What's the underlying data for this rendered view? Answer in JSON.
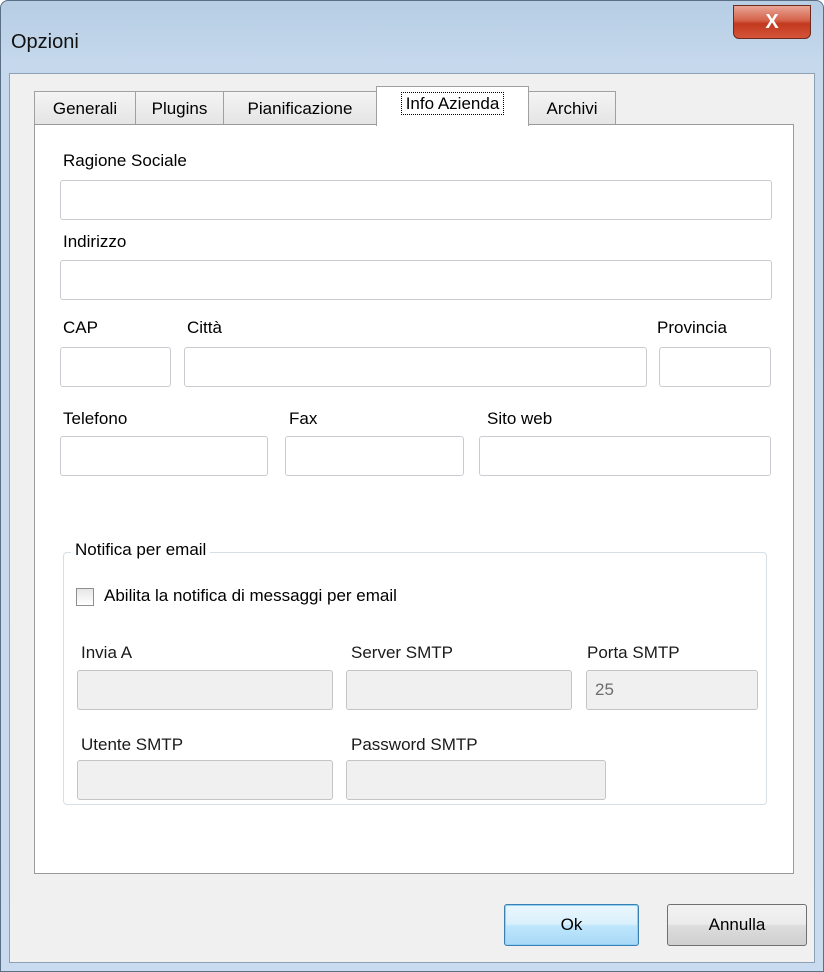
{
  "window": {
    "title": "Opzioni",
    "close_label": "X"
  },
  "tabs": [
    {
      "label": "Generali",
      "active": false
    },
    {
      "label": "Plugins",
      "active": false
    },
    {
      "label": "Pianificazione",
      "active": false
    },
    {
      "label": "Info Azienda",
      "active": true
    },
    {
      "label": "Archivi",
      "active": false
    }
  ],
  "company": {
    "ragione_sociale": {
      "label": "Ragione Sociale",
      "value": ""
    },
    "indirizzo": {
      "label": "Indirizzo",
      "value": ""
    },
    "cap": {
      "label": "CAP",
      "value": ""
    },
    "citta": {
      "label": "Città",
      "value": ""
    },
    "provincia": {
      "label": "Provincia",
      "value": ""
    },
    "telefono": {
      "label": "Telefono",
      "value": ""
    },
    "fax": {
      "label": "Fax",
      "value": ""
    },
    "sito_web": {
      "label": "Sito web",
      "value": ""
    }
  },
  "email_notification": {
    "group_label": "Notifica per email",
    "enable_label": "Abilita la notifica di messaggi per email",
    "enabled": false,
    "invia_a": {
      "label": "Invia A",
      "value": ""
    },
    "server_smtp": {
      "label": "Server SMTP",
      "value": ""
    },
    "porta_smtp": {
      "label": "Porta SMTP",
      "value": "25"
    },
    "utente_smtp": {
      "label": "Utente SMTP",
      "value": ""
    },
    "password_smtp": {
      "label": "Password SMTP",
      "value": ""
    }
  },
  "buttons": {
    "ok": "Ok",
    "cancel": "Annulla"
  }
}
